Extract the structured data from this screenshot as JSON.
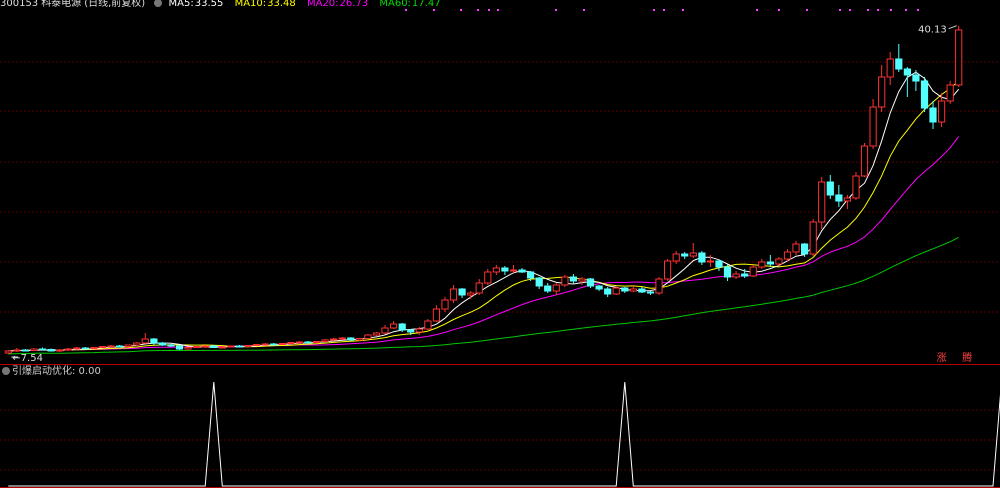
{
  "header": {
    "stock_code": "300153",
    "stock_name": "科泰电源",
    "period": "(日线,前复权)",
    "ma5_label": "MA5:",
    "ma5_value": "33.55",
    "ma10_label": "MA10:",
    "ma10_value": "33.48",
    "ma20_label": "MA20:",
    "ma20_value": "26.73",
    "ma60_label": "MA60:",
    "ma60_value": "17.47"
  },
  "colors": {
    "up": "#ff3232",
    "down": "#54ffff",
    "ma5": "#ffffff",
    "ma10": "#ffff00",
    "ma20": "#ff00ff",
    "ma60": "#00c800",
    "grid": "#5a0000"
  },
  "chart_data": [
    {
      "type": "candlestick",
      "title": "300153 科泰电源(日线,前复权)",
      "high_label": "40.13",
      "low_label": "7.54",
      "markers": [
        "涨",
        "腾"
      ],
      "ylim": [
        6.5,
        41.5
      ],
      "candles": [
        {
          "o": 7.4,
          "h": 7.7,
          "l": 7.3,
          "c": 7.6
        },
        {
          "o": 7.6,
          "h": 7.9,
          "l": 7.5,
          "c": 7.7
        },
        {
          "o": 7.7,
          "h": 7.8,
          "l": 7.6,
          "c": 7.65
        },
        {
          "o": 7.65,
          "h": 7.9,
          "l": 7.6,
          "c": 7.8
        },
        {
          "o": 7.8,
          "h": 7.95,
          "l": 7.7,
          "c": 7.75
        },
        {
          "o": 7.75,
          "h": 7.85,
          "l": 7.54,
          "c": 7.6
        },
        {
          "o": 7.6,
          "h": 7.8,
          "l": 7.5,
          "c": 7.7
        },
        {
          "o": 7.7,
          "h": 7.9,
          "l": 7.6,
          "c": 7.8
        },
        {
          "o": 7.8,
          "h": 8.0,
          "l": 7.7,
          "c": 7.9
        },
        {
          "o": 7.9,
          "h": 8.0,
          "l": 7.8,
          "c": 7.85
        },
        {
          "o": 7.85,
          "h": 8.0,
          "l": 7.8,
          "c": 7.95
        },
        {
          "o": 7.95,
          "h": 8.1,
          "l": 7.9,
          "c": 8.05
        },
        {
          "o": 8.05,
          "h": 8.2,
          "l": 7.95,
          "c": 8.1
        },
        {
          "o": 8.1,
          "h": 8.2,
          "l": 8.0,
          "c": 8.05
        },
        {
          "o": 8.05,
          "h": 8.25,
          "l": 8.0,
          "c": 8.2
        },
        {
          "o": 8.2,
          "h": 8.5,
          "l": 8.1,
          "c": 8.4
        },
        {
          "o": 8.4,
          "h": 9.4,
          "l": 8.3,
          "c": 8.8
        },
        {
          "o": 8.8,
          "h": 8.9,
          "l": 8.2,
          "c": 8.4
        },
        {
          "o": 8.4,
          "h": 8.5,
          "l": 8.1,
          "c": 8.2
        },
        {
          "o": 8.2,
          "h": 8.3,
          "l": 8.0,
          "c": 8.1
        },
        {
          "o": 8.1,
          "h": 8.2,
          "l": 7.7,
          "c": 7.8
        },
        {
          "o": 7.8,
          "h": 8.0,
          "l": 7.7,
          "c": 7.95
        },
        {
          "o": 7.95,
          "h": 8.1,
          "l": 7.9,
          "c": 8.05
        },
        {
          "o": 8.05,
          "h": 8.2,
          "l": 7.9,
          "c": 8.1
        },
        {
          "o": 8.1,
          "h": 8.2,
          "l": 7.9,
          "c": 7.95
        },
        {
          "o": 7.95,
          "h": 8.1,
          "l": 7.9,
          "c": 8.0
        },
        {
          "o": 8.0,
          "h": 8.15,
          "l": 7.95,
          "c": 8.1
        },
        {
          "o": 8.1,
          "h": 8.2,
          "l": 8.0,
          "c": 8.05
        },
        {
          "o": 8.05,
          "h": 8.2,
          "l": 8.0,
          "c": 8.15
        },
        {
          "o": 8.15,
          "h": 8.3,
          "l": 8.1,
          "c": 8.25
        },
        {
          "o": 8.25,
          "h": 8.4,
          "l": 8.2,
          "c": 8.3
        },
        {
          "o": 8.3,
          "h": 8.4,
          "l": 8.2,
          "c": 8.25
        },
        {
          "o": 8.25,
          "h": 8.4,
          "l": 8.2,
          "c": 8.35
        },
        {
          "o": 8.35,
          "h": 8.5,
          "l": 8.3,
          "c": 8.45
        },
        {
          "o": 8.45,
          "h": 8.6,
          "l": 8.4,
          "c": 8.5
        },
        {
          "o": 8.5,
          "h": 8.6,
          "l": 8.4,
          "c": 8.45
        },
        {
          "o": 8.45,
          "h": 8.6,
          "l": 8.4,
          "c": 8.55
        },
        {
          "o": 8.55,
          "h": 8.8,
          "l": 8.5,
          "c": 8.7
        },
        {
          "o": 8.7,
          "h": 8.9,
          "l": 8.6,
          "c": 8.8
        },
        {
          "o": 8.8,
          "h": 9.0,
          "l": 8.7,
          "c": 8.9
        },
        {
          "o": 8.9,
          "h": 9.0,
          "l": 8.6,
          "c": 8.7
        },
        {
          "o": 8.7,
          "h": 8.9,
          "l": 8.6,
          "c": 8.85
        },
        {
          "o": 8.85,
          "h": 9.3,
          "l": 8.8,
          "c": 9.2
        },
        {
          "o": 9.2,
          "h": 9.5,
          "l": 9.1,
          "c": 9.4
        },
        {
          "o": 9.4,
          "h": 10.2,
          "l": 9.3,
          "c": 9.9
        },
        {
          "o": 9.9,
          "h": 10.6,
          "l": 9.8,
          "c": 10.3
        },
        {
          "o": 10.3,
          "h": 10.4,
          "l": 9.5,
          "c": 9.7
        },
        {
          "o": 9.7,
          "h": 9.8,
          "l": 9.2,
          "c": 9.5
        },
        {
          "o": 9.5,
          "h": 10.0,
          "l": 9.2,
          "c": 9.8
        },
        {
          "o": 9.8,
          "h": 10.8,
          "l": 9.7,
          "c": 10.6
        },
        {
          "o": 10.6,
          "h": 12.2,
          "l": 10.5,
          "c": 11.8
        },
        {
          "o": 11.8,
          "h": 13.0,
          "l": 11.5,
          "c": 12.7
        },
        {
          "o": 12.7,
          "h": 14.2,
          "l": 12.4,
          "c": 13.8
        },
        {
          "o": 13.8,
          "h": 13.9,
          "l": 12.9,
          "c": 13.2
        },
        {
          "o": 13.2,
          "h": 13.6,
          "l": 12.8,
          "c": 13.4
        },
        {
          "o": 13.4,
          "h": 14.8,
          "l": 13.2,
          "c": 14.4
        },
        {
          "o": 14.4,
          "h": 15.8,
          "l": 14.2,
          "c": 15.5
        },
        {
          "o": 15.5,
          "h": 16.2,
          "l": 15.2,
          "c": 15.9
        },
        {
          "o": 15.9,
          "h": 16.1,
          "l": 15.2,
          "c": 15.6
        },
        {
          "o": 15.6,
          "h": 16.2,
          "l": 15.4,
          "c": 15.7
        },
        {
          "o": 15.7,
          "h": 15.9,
          "l": 15.4,
          "c": 15.5
        },
        {
          "o": 15.5,
          "h": 15.6,
          "l": 14.6,
          "c": 14.9
        },
        {
          "o": 14.9,
          "h": 15.0,
          "l": 13.8,
          "c": 14.1
        },
        {
          "o": 14.1,
          "h": 14.4,
          "l": 13.4,
          "c": 13.6
        },
        {
          "o": 13.6,
          "h": 14.4,
          "l": 13.2,
          "c": 14.2
        },
        {
          "o": 14.2,
          "h": 15.2,
          "l": 14.0,
          "c": 15.0
        },
        {
          "o": 15.0,
          "h": 15.3,
          "l": 14.3,
          "c": 14.6
        },
        {
          "o": 14.6,
          "h": 15.0,
          "l": 14.2,
          "c": 14.8
        },
        {
          "o": 14.8,
          "h": 14.9,
          "l": 13.9,
          "c": 14.1
        },
        {
          "o": 14.1,
          "h": 14.2,
          "l": 13.6,
          "c": 13.8
        },
        {
          "o": 13.8,
          "h": 14.0,
          "l": 13.0,
          "c": 13.3
        },
        {
          "o": 13.3,
          "h": 14.1,
          "l": 13.2,
          "c": 13.9
        },
        {
          "o": 13.9,
          "h": 14.0,
          "l": 13.4,
          "c": 13.6
        },
        {
          "o": 13.6,
          "h": 14.2,
          "l": 13.5,
          "c": 13.8
        },
        {
          "o": 13.8,
          "h": 14.0,
          "l": 13.4,
          "c": 13.5
        },
        {
          "o": 13.5,
          "h": 13.6,
          "l": 13.2,
          "c": 13.4
        },
        {
          "o": 13.4,
          "h": 15.0,
          "l": 13.2,
          "c": 14.8
        },
        {
          "o": 14.8,
          "h": 16.8,
          "l": 14.6,
          "c": 16.6
        },
        {
          "o": 16.6,
          "h": 17.6,
          "l": 16.3,
          "c": 17.3
        },
        {
          "o": 17.3,
          "h": 17.5,
          "l": 16.8,
          "c": 17.1
        },
        {
          "o": 17.1,
          "h": 18.4,
          "l": 16.9,
          "c": 17.4
        },
        {
          "o": 17.4,
          "h": 17.6,
          "l": 16.2,
          "c": 16.5
        },
        {
          "o": 16.5,
          "h": 17.2,
          "l": 16.0,
          "c": 16.6
        },
        {
          "o": 16.6,
          "h": 16.7,
          "l": 15.6,
          "c": 16.0
        },
        {
          "o": 16.0,
          "h": 16.3,
          "l": 14.6,
          "c": 15.0
        },
        {
          "o": 15.0,
          "h": 15.6,
          "l": 14.8,
          "c": 15.3
        },
        {
          "o": 15.3,
          "h": 15.8,
          "l": 14.9,
          "c": 15.1
        },
        {
          "o": 15.1,
          "h": 16.2,
          "l": 15.0,
          "c": 16.0
        },
        {
          "o": 16.0,
          "h": 16.8,
          "l": 15.8,
          "c": 16.5
        },
        {
          "o": 16.5,
          "h": 17.2,
          "l": 16.0,
          "c": 16.3
        },
        {
          "o": 16.3,
          "h": 17.0,
          "l": 16.1,
          "c": 16.8
        },
        {
          "o": 16.8,
          "h": 17.8,
          "l": 16.6,
          "c": 17.5
        },
        {
          "o": 17.5,
          "h": 18.6,
          "l": 17.2,
          "c": 18.3
        },
        {
          "o": 18.3,
          "h": 18.4,
          "l": 17.0,
          "c": 17.3
        },
        {
          "o": 17.3,
          "h": 20.8,
          "l": 17.1,
          "c": 20.5
        },
        {
          "o": 20.5,
          "h": 25.0,
          "l": 19.8,
          "c": 24.5
        },
        {
          "o": 24.5,
          "h": 25.2,
          "l": 22.8,
          "c": 23.2
        },
        {
          "o": 23.2,
          "h": 24.2,
          "l": 22.0,
          "c": 22.6
        },
        {
          "o": 22.6,
          "h": 23.2,
          "l": 21.8,
          "c": 22.9
        },
        {
          "o": 22.9,
          "h": 25.5,
          "l": 22.7,
          "c": 25.1
        },
        {
          "o": 25.1,
          "h": 28.4,
          "l": 25.0,
          "c": 28.1
        },
        {
          "o": 28.1,
          "h": 32.8,
          "l": 27.8,
          "c": 32.0
        },
        {
          "o": 32.0,
          "h": 36.2,
          "l": 31.5,
          "c": 35.0
        },
        {
          "o": 35.0,
          "h": 37.5,
          "l": 34.2,
          "c": 36.8
        },
        {
          "o": 36.8,
          "h": 38.3,
          "l": 35.5,
          "c": 35.8
        },
        {
          "o": 35.8,
          "h": 36.0,
          "l": 33.0,
          "c": 35.2
        },
        {
          "o": 35.2,
          "h": 35.7,
          "l": 33.6,
          "c": 34.6
        },
        {
          "o": 34.6,
          "h": 35.0,
          "l": 31.5,
          "c": 31.9
        },
        {
          "o": 31.9,
          "h": 32.6,
          "l": 29.8,
          "c": 30.5
        },
        {
          "o": 30.5,
          "h": 33.4,
          "l": 30.0,
          "c": 32.6
        },
        {
          "o": 32.6,
          "h": 34.6,
          "l": 32.3,
          "c": 34.2
        },
        {
          "o": 34.2,
          "h": 40.13,
          "l": 34.0,
          "c": 39.7
        }
      ]
    },
    {
      "type": "line",
      "title": "引爆启动优化",
      "value_label": ": 0.00",
      "ylim": [
        0,
        1
      ],
      "series": [
        {
          "values": [
            0,
            0,
            0,
            0,
            0,
            0,
            0,
            0,
            0,
            0,
            0,
            0,
            0,
            0,
            0,
            0,
            0,
            0,
            0,
            0,
            0,
            0,
            0,
            0,
            1,
            0,
            0,
            0,
            0,
            0,
            0,
            0,
            0,
            0,
            0,
            0,
            0,
            0,
            0,
            0,
            0,
            0,
            0,
            0,
            0,
            0,
            0,
            0,
            0,
            0,
            0,
            0,
            0,
            0,
            0,
            0,
            0,
            0,
            0,
            0,
            0,
            0,
            0,
            0,
            0,
            0,
            0,
            0,
            0,
            0,
            0,
            0,
            1,
            0,
            0,
            0,
            0,
            0,
            0,
            0,
            0,
            0,
            0,
            0,
            0,
            0,
            0,
            0,
            0,
            0,
            0,
            0,
            0,
            0,
            0,
            0,
            0,
            0,
            0,
            0,
            0,
            0,
            0,
            0,
            0,
            0,
            0,
            0,
            0,
            0,
            0,
            0,
            0,
            0,
            0,
            0,
            1,
            0,
            0,
            0
          ]
        }
      ]
    }
  ]
}
